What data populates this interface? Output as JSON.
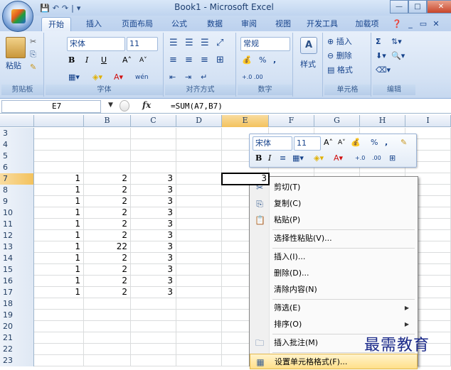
{
  "window": {
    "title": "Book1 - Microsoft Excel",
    "controls": [
      "—",
      "□",
      "✕"
    ]
  },
  "qat": {
    "save": "💾",
    "undo": "↶",
    "redo": "↷",
    "sep": "|",
    "custom": "▾"
  },
  "tabs": [
    "开始",
    "插入",
    "页面布局",
    "公式",
    "数据",
    "审阅",
    "视图",
    "开发工具",
    "加载项"
  ],
  "tab_right": {
    "help": "❓",
    "min": "_",
    "restore": "▭",
    "close": "✕"
  },
  "ribbon": {
    "clipboard": {
      "paste": "粘贴",
      "label": "剪贴板"
    },
    "font": {
      "name": "宋体",
      "size": "11",
      "bold": "B",
      "italic": "I",
      "underline": "U",
      "grow": "A˄",
      "shrink": "A˅",
      "label": "字体",
      "phonetic": "wén"
    },
    "alignment": {
      "label": "对齐方式"
    },
    "number": {
      "format": "常规",
      "percent": "%",
      "comma": ",",
      "inc": "+.0 .00",
      "dec": ".00 +.0",
      "label": "数字"
    },
    "styles": {
      "label": "样式"
    },
    "cells": {
      "insert": "插入",
      "delete": "删除",
      "format": "格式",
      "label": "单元格"
    },
    "editing": {
      "sum": "Σ",
      "sort": "排序",
      "label": "编辑"
    }
  },
  "formula_bar": {
    "cell_ref": "E7",
    "fx": "fx",
    "formula": "=SUM(A7,B7)"
  },
  "columns": [
    "B",
    "C",
    "D",
    "E",
    "F",
    "G",
    "H",
    "I"
  ],
  "rows": [
    {
      "num": "3",
      "a": "",
      "b": "",
      "c": ""
    },
    {
      "num": "4",
      "a": "",
      "b": "",
      "c": ""
    },
    {
      "num": "5",
      "a": "",
      "b": "",
      "c": ""
    },
    {
      "num": "6",
      "a": "",
      "b": "",
      "c": ""
    },
    {
      "num": "7",
      "a": "1",
      "b": "2",
      "c": "3"
    },
    {
      "num": "8",
      "a": "1",
      "b": "2",
      "c": "3"
    },
    {
      "num": "9",
      "a": "1",
      "b": "2",
      "c": "3"
    },
    {
      "num": "10",
      "a": "1",
      "b": "2",
      "c": "3"
    },
    {
      "num": "11",
      "a": "1",
      "b": "2",
      "c": "3"
    },
    {
      "num": "12",
      "a": "1",
      "b": "2",
      "c": "3"
    },
    {
      "num": "13",
      "a": "1",
      "b": "22",
      "c": "3"
    },
    {
      "num": "14",
      "a": "1",
      "b": "2",
      "c": "3"
    },
    {
      "num": "15",
      "a": "1",
      "b": "2",
      "c": "3"
    },
    {
      "num": "16",
      "a": "1",
      "b": "2",
      "c": "3"
    },
    {
      "num": "17",
      "a": "1",
      "b": "2",
      "c": "3"
    },
    {
      "num": "18",
      "a": "",
      "b": "",
      "c": ""
    },
    {
      "num": "19",
      "a": "",
      "b": "",
      "c": ""
    },
    {
      "num": "20",
      "a": "",
      "b": "",
      "c": ""
    },
    {
      "num": "21",
      "a": "",
      "b": "",
      "c": ""
    },
    {
      "num": "22",
      "a": "",
      "b": "",
      "c": ""
    },
    {
      "num": "23",
      "a": "",
      "b": "",
      "c": ""
    }
  ],
  "selected_cell_value": "3",
  "mini_toolbar": {
    "font": "宋体",
    "size": "11",
    "bold": "B",
    "italic": "I",
    "percent": "%",
    "comma": ","
  },
  "context_menu": [
    {
      "label": "剪切(T)",
      "icon": "✂"
    },
    {
      "label": "复制(C)",
      "icon": "⎘"
    },
    {
      "label": "粘贴(P)",
      "icon": "📋"
    },
    {
      "label": "选择性粘贴(V)...",
      "icon": ""
    },
    {
      "label": "插入(I)...",
      "icon": ""
    },
    {
      "label": "删除(D)...",
      "icon": ""
    },
    {
      "label": "清除内容(N)",
      "icon": ""
    },
    {
      "label": "筛选(E)",
      "icon": "",
      "submenu": "▶"
    },
    {
      "label": "排序(O)",
      "icon": "",
      "submenu": "▶"
    },
    {
      "label": "插入批注(M)",
      "icon": "🗀"
    },
    {
      "label": "设置单元格格式(F)...",
      "icon": "▦"
    }
  ],
  "watermark": "最需教育"
}
